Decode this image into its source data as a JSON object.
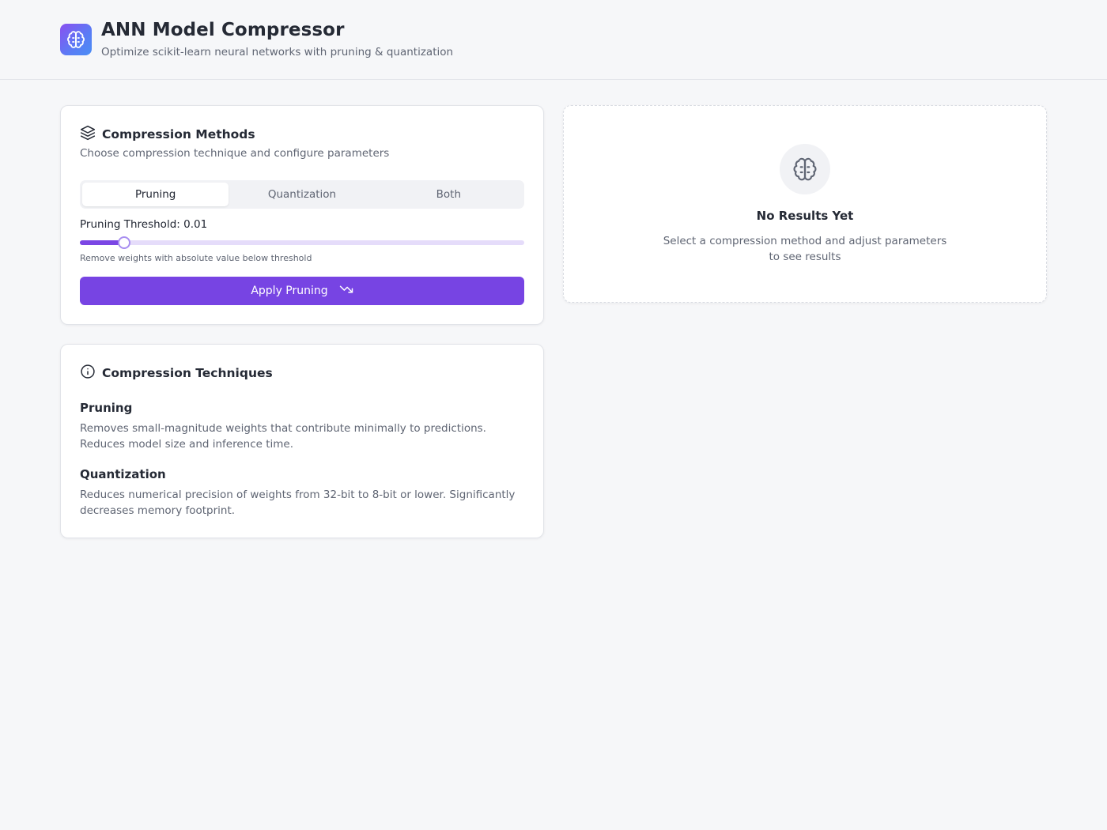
{
  "header": {
    "title": "ANN Model Compressor",
    "subtitle": "Optimize scikit-learn neural networks with pruning & quantization",
    "logo_icon": "brain-icon"
  },
  "methods": {
    "icon": "layers-icon",
    "title": "Compression Methods",
    "description": "Choose compression technique and configure parameters",
    "tabs": [
      {
        "label": "Pruning",
        "active": true
      },
      {
        "label": "Quantization",
        "active": false
      },
      {
        "label": "Both",
        "active": false
      }
    ],
    "threshold_label": "Pruning Threshold: 0.01",
    "slider_fraction": 0.1,
    "threshold_hint": "Remove weights with absolute value below threshold",
    "apply_label": "Apply Pruning",
    "apply_icon": "trending-down-icon"
  },
  "techniques": {
    "icon": "info-icon",
    "title": "Compression Techniques",
    "items": [
      {
        "name": "Pruning",
        "description": "Removes small-magnitude weights that contribute minimally to predictions. Reduces model size and inference time."
      },
      {
        "name": "Quantization",
        "description": "Reduces numerical precision of weights from 32-bit to 8-bit or lower. Significantly decreases memory footprint."
      }
    ]
  },
  "results": {
    "icon": "brain-icon",
    "title": "No Results Yet",
    "description": "Select a compression method and adjust parameters to see results"
  },
  "colors": {
    "accent": "#7744e3",
    "background": "#f6f7f9",
    "muted_text": "#5f6573"
  }
}
